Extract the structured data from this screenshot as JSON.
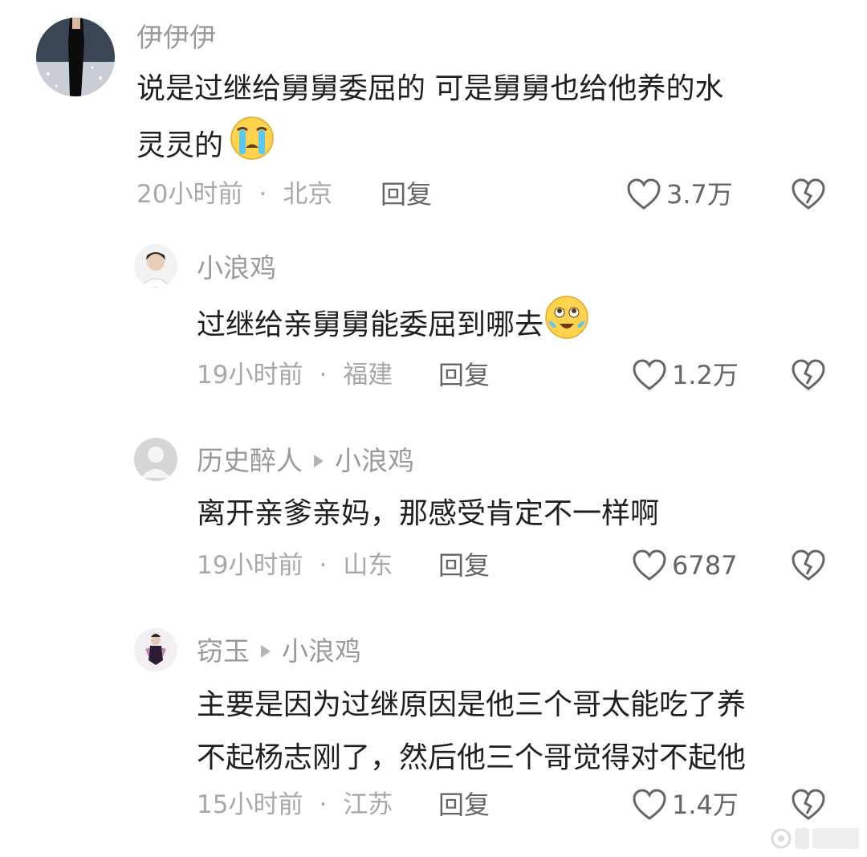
{
  "comments": [
    {
      "username": "伊伊伊",
      "lines": [
        "说是过继给舅舅委屈的 可是舅舅也给他养的水",
        "灵灵的"
      ],
      "time": "20小时前",
      "location": "北京",
      "reply_label": "回复",
      "likes": "3.7万",
      "emoji_icon": "loudly-crying-face-icon"
    },
    {
      "username": "小浪鸡",
      "lines": [
        "过继给亲舅舅能委屈到哪去"
      ],
      "time": "19小时前",
      "location": "福建",
      "reply_label": "回复",
      "likes": "1.2万",
      "emoji_icon": "laughing-tears-face-icon"
    },
    {
      "username": "历史醉人",
      "reply_to": "小浪鸡",
      "lines": [
        "离开亲爹亲妈，那感受肯定不一样啊"
      ],
      "time": "19小时前",
      "location": "山东",
      "reply_label": "回复",
      "likes": "6787"
    },
    {
      "username": "窃玉",
      "reply_to": "小浪鸡",
      "lines": [
        "主要是因为过继原因是他三个哥太能吃了养",
        "不起杨志刚了，然后他三个哥觉得对不起他"
      ],
      "time": "15小时前",
      "location": "江苏",
      "reply_label": "回复",
      "likes": "1.4万"
    }
  ],
  "icons": {
    "like": "heart-outline-icon",
    "dislike": "broken-heart-icon",
    "reply_arrow": "triangle-right-icon"
  },
  "colors": {
    "username": "#9a9a9a",
    "text": "#1f1f1f",
    "meta": "#a8a8a8",
    "action": "#666666"
  }
}
